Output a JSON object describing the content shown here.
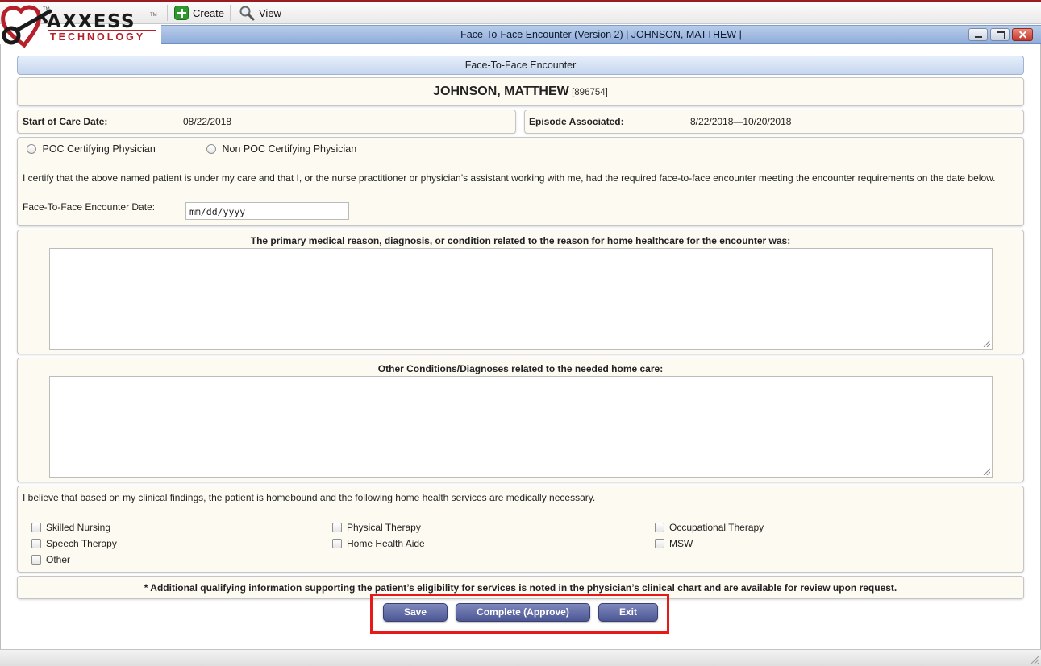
{
  "toolbar": {
    "create_label": "Create",
    "view_label": "View"
  },
  "logo": {
    "brand": "AXXESS",
    "sub": "TECHNOLOGY",
    "tm": "TM"
  },
  "window": {
    "title": "Face-To-Face Encounter (Version 2) | JOHNSON, MATTHEW |"
  },
  "form": {
    "header": "Face-To-Face Encounter",
    "patient": {
      "name": "JOHNSON, MATTHEW",
      "id": "[896754]"
    },
    "start_of_care": {
      "label": "Start of Care Date:",
      "value": "08/22/2018"
    },
    "episode": {
      "label": "Episode Associated:",
      "value": "8/22/2018—10/20/2018"
    },
    "physician_options": [
      "POC Certifying Physician",
      "Non POC Certifying Physician"
    ],
    "certify_text": "I certify that the above named patient is under my care and that I, or the nurse practitioner or physician’s assistant working with me, had the required face-to-face encounter meeting the encounter requirements on the date below.",
    "encounter_date": {
      "label": "Face-To-Face Encounter Date:",
      "placeholder": "mm/dd/yyyy"
    },
    "primary_reason_label": "The primary medical reason, diagnosis, or condition related to the reason for home healthcare for the encounter was:",
    "other_conditions_label": "Other Conditions/Diagnoses related to the needed home care:",
    "homebound_text": "I believe that based on my clinical findings, the patient is homebound and the following home health services are medically necessary.",
    "services": [
      "Skilled Nursing",
      "Physical Therapy",
      "Occupational Therapy",
      "Speech Therapy",
      "Home Health Aide",
      "MSW",
      "Other"
    ],
    "footnote": "* Additional qualifying information supporting the patient’s eligibility for services is noted in the physician’s clinical chart and are available for review upon request."
  },
  "buttons": {
    "save": "Save",
    "complete": "Complete (Approve)",
    "exit": "Exit"
  },
  "colors": {
    "accent_red": "#9b1b22",
    "button_blue": "#4d5794",
    "panel_bg": "#fdfbf1",
    "highlight": "#e81919"
  }
}
